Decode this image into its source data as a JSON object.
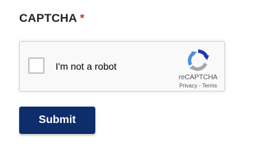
{
  "form": {
    "captcha_label": "CAPTCHA",
    "required_marker": "*",
    "submit_label": "Submit"
  },
  "captcha": {
    "checkbox_text": "I'm not a robot",
    "brand": "reCAPTCHA",
    "privacy_link": "Privacy",
    "separator": " - ",
    "terms_link": "Terms",
    "checked": false
  },
  "colors": {
    "submit_bg": "#0d2d6b",
    "required": "#c0392b",
    "logo_blue": "#1c3aa9",
    "logo_light_blue": "#4a90e2",
    "logo_gray": "#a6a6a6"
  },
  "icons": {
    "recaptcha_logo": "recaptcha-logo-icon"
  }
}
